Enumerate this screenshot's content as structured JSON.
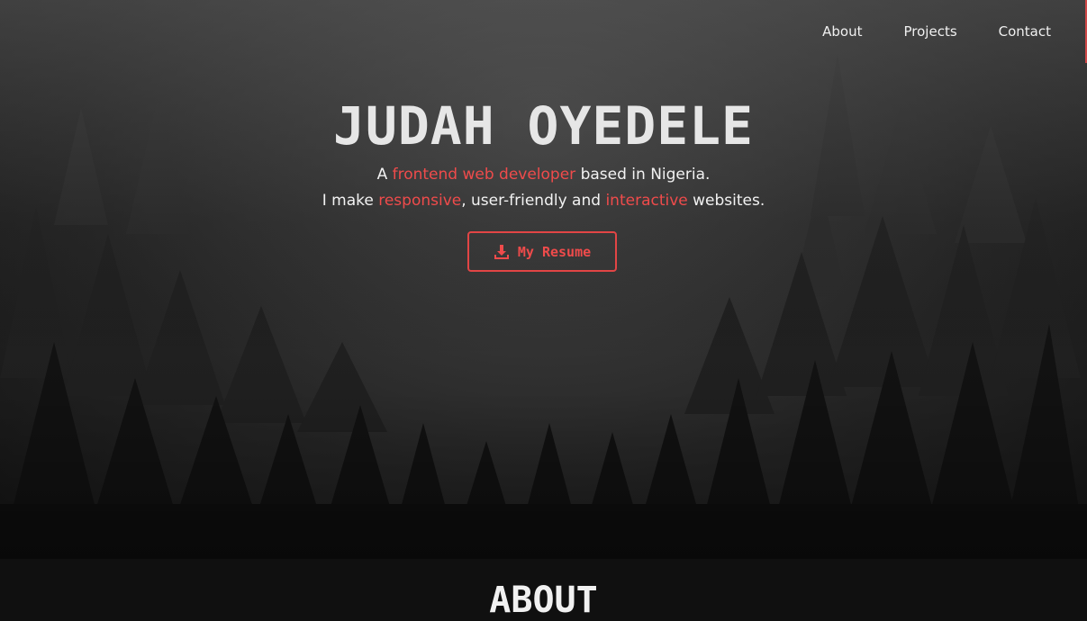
{
  "nav": {
    "items": [
      {
        "label": "About"
      },
      {
        "label": "Projects"
      },
      {
        "label": "Contact"
      }
    ]
  },
  "hero": {
    "title": "JUDAH OYEDELE",
    "line1": {
      "before": "A ",
      "highlight": "frontend web developer",
      "after": " based in Nigeria."
    },
    "line2": {
      "before": "I make ",
      "highlight1": "responsive",
      "middle": ", user-friendly and ",
      "highlight2": "interactive",
      "after": " websites."
    },
    "resume_button": {
      "label": "My Resume",
      "icon": "download-icon"
    }
  },
  "about": {
    "heading": "ABOUT"
  },
  "colors": {
    "accent": "#ef4b4b",
    "text": "#ececec",
    "background": "#101010"
  }
}
